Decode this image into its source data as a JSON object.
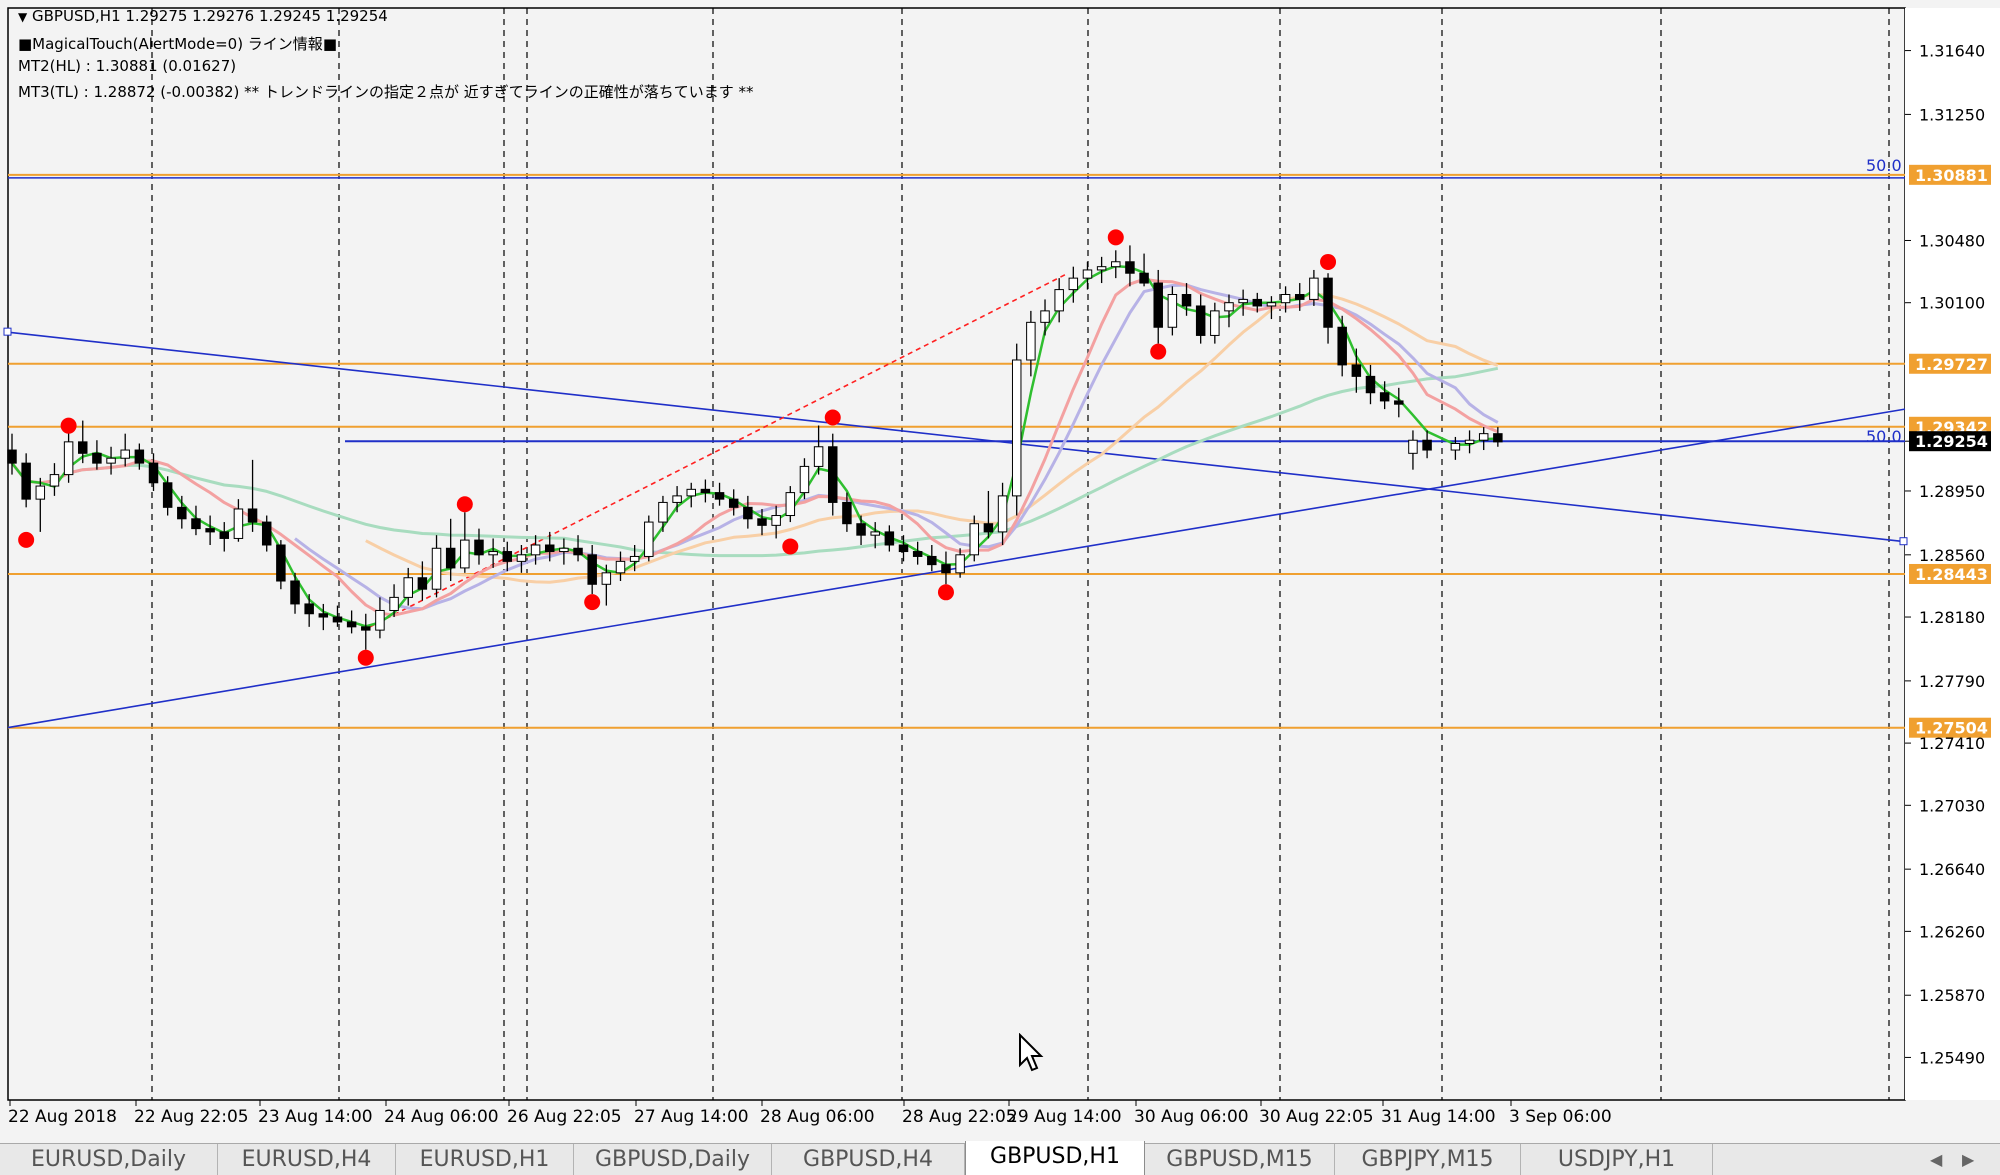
{
  "header": {
    "symbol_line": "GBPUSD,H1  1.29275 1.29276 1.29245 1.29254",
    "indicator_line": "■MagicalTouch(AlertMode=0) ライン情報■",
    "mt2_line": "MT2(HL) : 1.30881 (0.01627)",
    "mt3_line": "MT3(TL) : 1.28872 (-0.00382)  ** トレンドラインの指定２点が  近すぎてラインの正確性が落ちています **"
  },
  "tabs": [
    {
      "label": "EURUSD,Daily",
      "active": false
    },
    {
      "label": "EURUSD,H4",
      "active": false
    },
    {
      "label": "EURUSD,H1",
      "active": false
    },
    {
      "label": "GBPUSD,Daily",
      "active": false
    },
    {
      "label": "GBPUSD,H4",
      "active": false
    },
    {
      "label": "GBPUSD,H1",
      "active": true
    },
    {
      "label": "GBPUSD,M15",
      "active": false
    },
    {
      "label": "GBPJPY,M15",
      "active": false
    },
    {
      "label": "USDJPY,H1",
      "active": false
    }
  ],
  "tab_nav": {
    "left": "◀",
    "right": "▶"
  },
  "colors": {
    "background": "#f3f3f3",
    "candle": "#000000",
    "hline": "#f0a030",
    "trendline": "#1f2fc8",
    "fast_ma": "#2fbf2f",
    "mid_ma": "#f3a1a1",
    "slow_ma": "#a8dcbf",
    "purple_ma": "#b7b2e6",
    "orange_ma": "#f8cfa6",
    "pivot": "#ff0000",
    "price_bg": "#000000"
  },
  "chart_data": {
    "type": "candlestick",
    "symbol": "GBPUSD",
    "timeframe": "H1",
    "ohlc": {
      "open": 1.29275,
      "high": 1.29276,
      "low": 1.29245,
      "close": 1.29254
    },
    "ylim": [
      1.2523,
      1.319
    ],
    "y_ticks": [
      1.3164,
      1.3125,
      1.3048,
      1.301,
      1.29727,
      1.29342,
      1.29254,
      1.2895,
      1.2856,
      1.28443,
      1.2818,
      1.2779,
      1.27504,
      1.2741,
      1.2703,
      1.2664,
      1.2626,
      1.2587,
      1.2549
    ],
    "x_ticks": [
      "22 Aug 2018",
      "22 Aug 22:05",
      "23 Aug 14:00",
      "24 Aug 06:00",
      "26 Aug 22:05",
      "27 Aug 14:00",
      "28 Aug 06:00",
      "28 Aug 22:05",
      "29 Aug 14:00",
      "30 Aug 06:00",
      "30 Aug 22:05",
      "31 Aug 14:00",
      "3 Sep 06:00"
    ],
    "horizontal_lines": [
      {
        "price": 1.30881,
        "label": "1.30881",
        "kind": "hl"
      },
      {
        "price": 1.29727,
        "label": "1.29727",
        "kind": "support"
      },
      {
        "price": 1.29342,
        "label": "1.29342",
        "kind": "support"
      },
      {
        "price": 1.28443,
        "label": "1.28443",
        "kind": "support"
      },
      {
        "price": 1.27504,
        "label": "1.27504",
        "kind": "support"
      }
    ],
    "fib_labels": [
      "50.0",
      "50.0"
    ],
    "current_price": "1.29254",
    "candles": [
      [
        1.292,
        1.293,
        1.2905,
        1.2912
      ],
      [
        1.2912,
        1.2918,
        1.2885,
        1.289
      ],
      [
        1.289,
        1.2903,
        1.287,
        1.2898
      ],
      [
        1.2898,
        1.2912,
        1.2892,
        1.2905
      ],
      [
        1.2905,
        1.2932,
        1.29,
        1.2925
      ],
      [
        1.2925,
        1.2938,
        1.2912,
        1.2918
      ],
      [
        1.2918,
        1.2926,
        1.2908,
        1.2912
      ],
      [
        1.2912,
        1.2922,
        1.2905,
        1.2915
      ],
      [
        1.2915,
        1.293,
        1.291,
        1.292
      ],
      [
        1.292,
        1.2924,
        1.2908,
        1.2912
      ],
      [
        1.2912,
        1.2918,
        1.2895,
        1.29
      ],
      [
        1.29,
        1.2904,
        1.288,
        1.2885
      ],
      [
        1.2885,
        1.2892,
        1.2872,
        1.2878
      ],
      [
        1.2878,
        1.2886,
        1.2868,
        1.2872
      ],
      [
        1.2872,
        1.288,
        1.2862,
        1.287
      ],
      [
        1.287,
        1.2876,
        1.2858,
        1.2866
      ],
      [
        1.2866,
        1.289,
        1.2864,
        1.2884
      ],
      [
        1.2884,
        1.2914,
        1.287,
        1.2876
      ],
      [
        1.2876,
        1.288,
        1.2858,
        1.2862
      ],
      [
        1.2862,
        1.2865,
        1.2835,
        1.284
      ],
      [
        1.284,
        1.2845,
        1.282,
        1.2826
      ],
      [
        1.2826,
        1.2832,
        1.2812,
        1.282
      ],
      [
        1.282,
        1.2826,
        1.281,
        1.2818
      ],
      [
        1.2818,
        1.2825,
        1.2812,
        1.2815
      ],
      [
        1.2815,
        1.2822,
        1.2808,
        1.2812
      ],
      [
        1.2812,
        1.282,
        1.2798,
        1.281
      ],
      [
        1.281,
        1.283,
        1.2805,
        1.2822
      ],
      [
        1.2822,
        1.2838,
        1.2818,
        1.283
      ],
      [
        1.283,
        1.2848,
        1.2825,
        1.2842
      ],
      [
        1.2842,
        1.2852,
        1.2828,
        1.2835
      ],
      [
        1.2835,
        1.2868,
        1.283,
        1.286
      ],
      [
        1.286,
        1.2878,
        1.284,
        1.2848
      ],
      [
        1.2848,
        1.2882,
        1.2845,
        1.2865
      ],
      [
        1.2865,
        1.2872,
        1.285,
        1.2856
      ],
      [
        1.2856,
        1.2866,
        1.2848,
        1.2858
      ],
      [
        1.2858,
        1.2864,
        1.2846,
        1.2852
      ],
      [
        1.2852,
        1.2862,
        1.2845,
        1.2856
      ],
      [
        1.2856,
        1.2868,
        1.285,
        1.2862
      ],
      [
        1.2862,
        1.287,
        1.2852,
        1.2858
      ],
      [
        1.2858,
        1.2866,
        1.285,
        1.286
      ],
      [
        1.286,
        1.2868,
        1.2852,
        1.2856
      ],
      [
        1.2856,
        1.2862,
        1.2832,
        1.2838
      ],
      [
        1.2838,
        1.285,
        1.2825,
        1.2845
      ],
      [
        1.2845,
        1.2858,
        1.284,
        1.2852
      ],
      [
        1.2852,
        1.2862,
        1.2846,
        1.2855
      ],
      [
        1.2855,
        1.288,
        1.2852,
        1.2876
      ],
      [
        1.2876,
        1.2892,
        1.287,
        1.2888
      ],
      [
        1.2888,
        1.2898,
        1.2882,
        1.2892
      ],
      [
        1.2892,
        1.29,
        1.2885,
        1.2896
      ],
      [
        1.2896,
        1.2902,
        1.2888,
        1.2894
      ],
      [
        1.2894,
        1.29,
        1.2886,
        1.289
      ],
      [
        1.289,
        1.2896,
        1.288,
        1.2885
      ],
      [
        1.2885,
        1.2892,
        1.2872,
        1.2878
      ],
      [
        1.2878,
        1.2884,
        1.2868,
        1.2874
      ],
      [
        1.2874,
        1.2886,
        1.2866,
        1.288
      ],
      [
        1.288,
        1.2898,
        1.2876,
        1.2894
      ],
      [
        1.2894,
        1.2915,
        1.289,
        1.291
      ],
      [
        1.291,
        1.2935,
        1.2905,
        1.2922
      ],
      [
        1.2922,
        1.293,
        1.288,
        1.2888
      ],
      [
        1.2888,
        1.2894,
        1.287,
        1.2875
      ],
      [
        1.2875,
        1.288,
        1.2862,
        1.2868
      ],
      [
        1.2868,
        1.2876,
        1.286,
        1.287
      ],
      [
        1.287,
        1.2874,
        1.2858,
        1.2862
      ],
      [
        1.2862,
        1.2868,
        1.2852,
        1.2858
      ],
      [
        1.2858,
        1.2864,
        1.285,
        1.2855
      ],
      [
        1.2855,
        1.2862,
        1.2846,
        1.285
      ],
      [
        1.285,
        1.2858,
        1.2838,
        1.2845
      ],
      [
        1.2845,
        1.286,
        1.2842,
        1.2856
      ],
      [
        1.2856,
        1.288,
        1.2852,
        1.2875
      ],
      [
        1.2875,
        1.2895,
        1.2866,
        1.287
      ],
      [
        1.287,
        1.29,
        1.2862,
        1.2892
      ],
      [
        1.2892,
        1.2985,
        1.288,
        1.2975
      ],
      [
        1.2975,
        1.3005,
        1.2965,
        1.2998
      ],
      [
        1.2998,
        1.3012,
        1.299,
        1.3005
      ],
      [
        1.3005,
        1.3025,
        1.2998,
        1.3018
      ],
      [
        1.3018,
        1.3032,
        1.301,
        1.3025
      ],
      [
        1.3025,
        1.3035,
        1.3018,
        1.303
      ],
      [
        1.303,
        1.3038,
        1.3022,
        1.3032
      ],
      [
        1.3032,
        1.3042,
        1.3025,
        1.3035
      ],
      [
        1.3035,
        1.3045,
        1.302,
        1.3028
      ],
      [
        1.3028,
        1.304,
        1.302,
        1.3022
      ],
      [
        1.3022,
        1.303,
        1.2985,
        1.2995
      ],
      [
        1.2995,
        1.302,
        1.299,
        1.3015
      ],
      [
        1.3015,
        1.3022,
        1.3002,
        1.3008
      ],
      [
        1.3008,
        1.3015,
        1.2985,
        1.299
      ],
      [
        1.299,
        1.301,
        1.2985,
        1.3005
      ],
      [
        1.3005,
        1.3015,
        1.2995,
        1.301
      ],
      [
        1.301,
        1.3018,
        1.3002,
        1.3012
      ],
      [
        1.3012,
        1.3016,
        1.3004,
        1.3008
      ],
      [
        1.3008,
        1.3014,
        1.3,
        1.301
      ],
      [
        1.301,
        1.302,
        1.3004,
        1.3015
      ],
      [
        1.3015,
        1.3022,
        1.3005,
        1.3012
      ],
      [
        1.3012,
        1.303,
        1.3008,
        1.3025
      ],
      [
        1.3025,
        1.3028,
        1.2985,
        1.2995
      ],
      [
        1.2995,
        1.3002,
        1.2965,
        1.2972
      ],
      [
        1.2972,
        1.2982,
        1.2955,
        1.2965
      ],
      [
        1.2965,
        1.2972,
        1.2948,
        1.2955
      ],
      [
        1.2955,
        1.2962,
        1.2945,
        1.295
      ],
      [
        1.295,
        1.2958,
        1.294,
        1.2948
      ],
      [
        1.2918,
        1.2932,
        1.2908,
        1.2926
      ],
      [
        1.2926,
        1.2932,
        1.2915,
        1.292
      ],
      [
        1.292,
        1.2928,
        1.2914,
        1.2924
      ],
      [
        1.2924,
        1.2932,
        1.2918,
        1.2926
      ],
      [
        1.2926,
        1.2934,
        1.292,
        1.293
      ],
      [
        1.293,
        1.2934,
        1.2922,
        1.2925
      ]
    ]
  }
}
